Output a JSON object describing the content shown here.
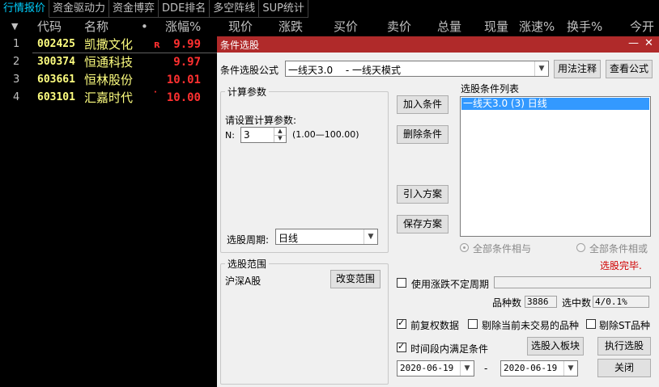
{
  "tabs": [
    "行情报价",
    "资金驱动力",
    "资金博弈",
    "DDE排名",
    "多空阵线",
    "SUP统计"
  ],
  "columns": {
    "sort": "▼",
    "code": "代码",
    "name": "名称",
    "dot": "•",
    "change_pct": "涨幅%",
    "price": "现价",
    "change": "涨跌",
    "bid": "买价",
    "ask": "卖价",
    "volume": "总量",
    "cur_vol": "现量",
    "speed": "涨速%",
    "turnover": "换手%",
    "open": "今开"
  },
  "rows": [
    {
      "idx": "1",
      "code": "002425",
      "name": "凯撒文化",
      "flag": "R",
      "chg": "9.99"
    },
    {
      "idx": "2",
      "code": "300374",
      "name": "恒通科技",
      "flag": "",
      "chg": "9.97"
    },
    {
      "idx": "3",
      "code": "603661",
      "name": "恒林股份",
      "flag": "",
      "chg": "10.01"
    },
    {
      "idx": "4",
      "code": "603101",
      "name": "汇嘉时代",
      "flag": "·",
      "chg": "10.00"
    }
  ],
  "dialog": {
    "title": "条件选股",
    "min_icon": "minimize-icon",
    "close_icon": "close-icon",
    "formula_label": "条件选股公式",
    "formula_value": "一线天3.0　 - 一线天模式",
    "btn_usage": "用法注释",
    "btn_view": "查看公式",
    "calc_group": "计算参数",
    "param_prompt": "请设置计算参数:",
    "param_name": "N:",
    "param_value": "3",
    "param_range": "(1.00—100.00)",
    "period_label": "选股周期:",
    "period_value": "日线",
    "btn_add": "加入条件",
    "btn_delete": "删除条件",
    "btn_import": "引入方案",
    "btn_save": "保存方案",
    "list_label": "选股条件列表",
    "list_items": [
      "一线天3.0 (3) 日线"
    ],
    "radio_and": "全部条件相与",
    "radio_or": "全部条件相或",
    "status": "选股完毕.",
    "range_group": "选股范围",
    "range_value": "沪深A股",
    "btn_change_range": "改变范围",
    "chk_uncertain": "使用涨跌不定周期",
    "count_label": "品种数",
    "count_value": "3886",
    "hit_label": "选中数",
    "hit_value": "4/0.1%",
    "chk_prerights": "前复权数据",
    "chk_exclude_nontrade": "剔除当前未交易的品种",
    "chk_exclude_st": "剔除ST品种",
    "chk_period": "时间段内满足条件",
    "btn_to_board": "选股入板块",
    "btn_execute": "执行选股",
    "date_from": "2020-06-19",
    "date_sep": "-",
    "date_to": "2020-06-19",
    "btn_close": "关闭"
  }
}
